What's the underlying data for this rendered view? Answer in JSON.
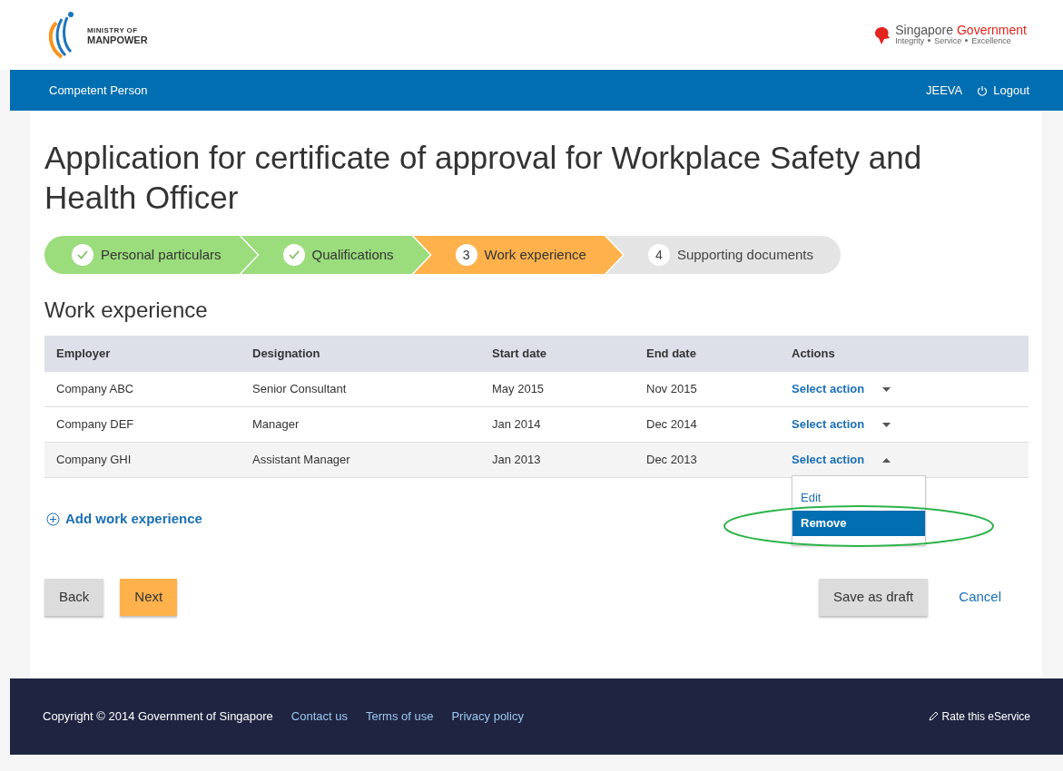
{
  "header": {
    "ministry_logo": {
      "line1": "MINISTRY OF",
      "line2": "MANPOWER"
    },
    "gov_logo": {
      "name_part1": "Singapore",
      "name_part2": "Government",
      "tagline": [
        "Integrity",
        "Service",
        "Excellence"
      ]
    }
  },
  "nav_bar": {
    "title": "Competent Person",
    "user": "JEEVA",
    "logout": "Logout"
  },
  "page_title": "Application for certificate of approval for Workplace Safety and Health Officer",
  "steps": [
    {
      "label": "Personal particulars",
      "done": true,
      "selected": false
    },
    {
      "label": "Qualifications",
      "done": true,
      "selected": false
    },
    {
      "number": "3",
      "label": "Work experience",
      "done": false,
      "selected": true
    },
    {
      "number": "4",
      "label": "Supporting documents",
      "done": false,
      "selected": false
    }
  ],
  "section_title": "Work experience",
  "table": {
    "columns": [
      "Employer",
      "Designation",
      "Start date",
      "End date",
      "Actions"
    ],
    "rows": [
      {
        "cells": [
          "Company ABC",
          "Senior Consultant",
          "May 2015",
          "Nov 2015"
        ],
        "action": "Select action",
        "expanded": false
      },
      {
        "cells": [
          "Company DEF",
          "Manager",
          "Jan 2014",
          "Dec 2014"
        ],
        "action": "Select action",
        "expanded": false
      },
      {
        "cells": [
          "Company GHI",
          "Assistant Manager",
          "Jan 2013",
          "Dec 2013"
        ],
        "action": "Select action",
        "expanded": true,
        "menu": [
          {
            "label": "Edit",
            "selected": false
          },
          {
            "label": "Remove",
            "selected": true
          }
        ]
      }
    ]
  },
  "add_link": "Add work experience",
  "buttons": {
    "back": "Back",
    "next": "Next",
    "save": "Save as draft",
    "cancel": "Cancel"
  },
  "footer": {
    "copyright": "Copyright © 2014 Government of Singapore",
    "links": [
      "Contact us",
      "Terms of use",
      "Privacy policy"
    ],
    "rate": "Rate this eService"
  }
}
